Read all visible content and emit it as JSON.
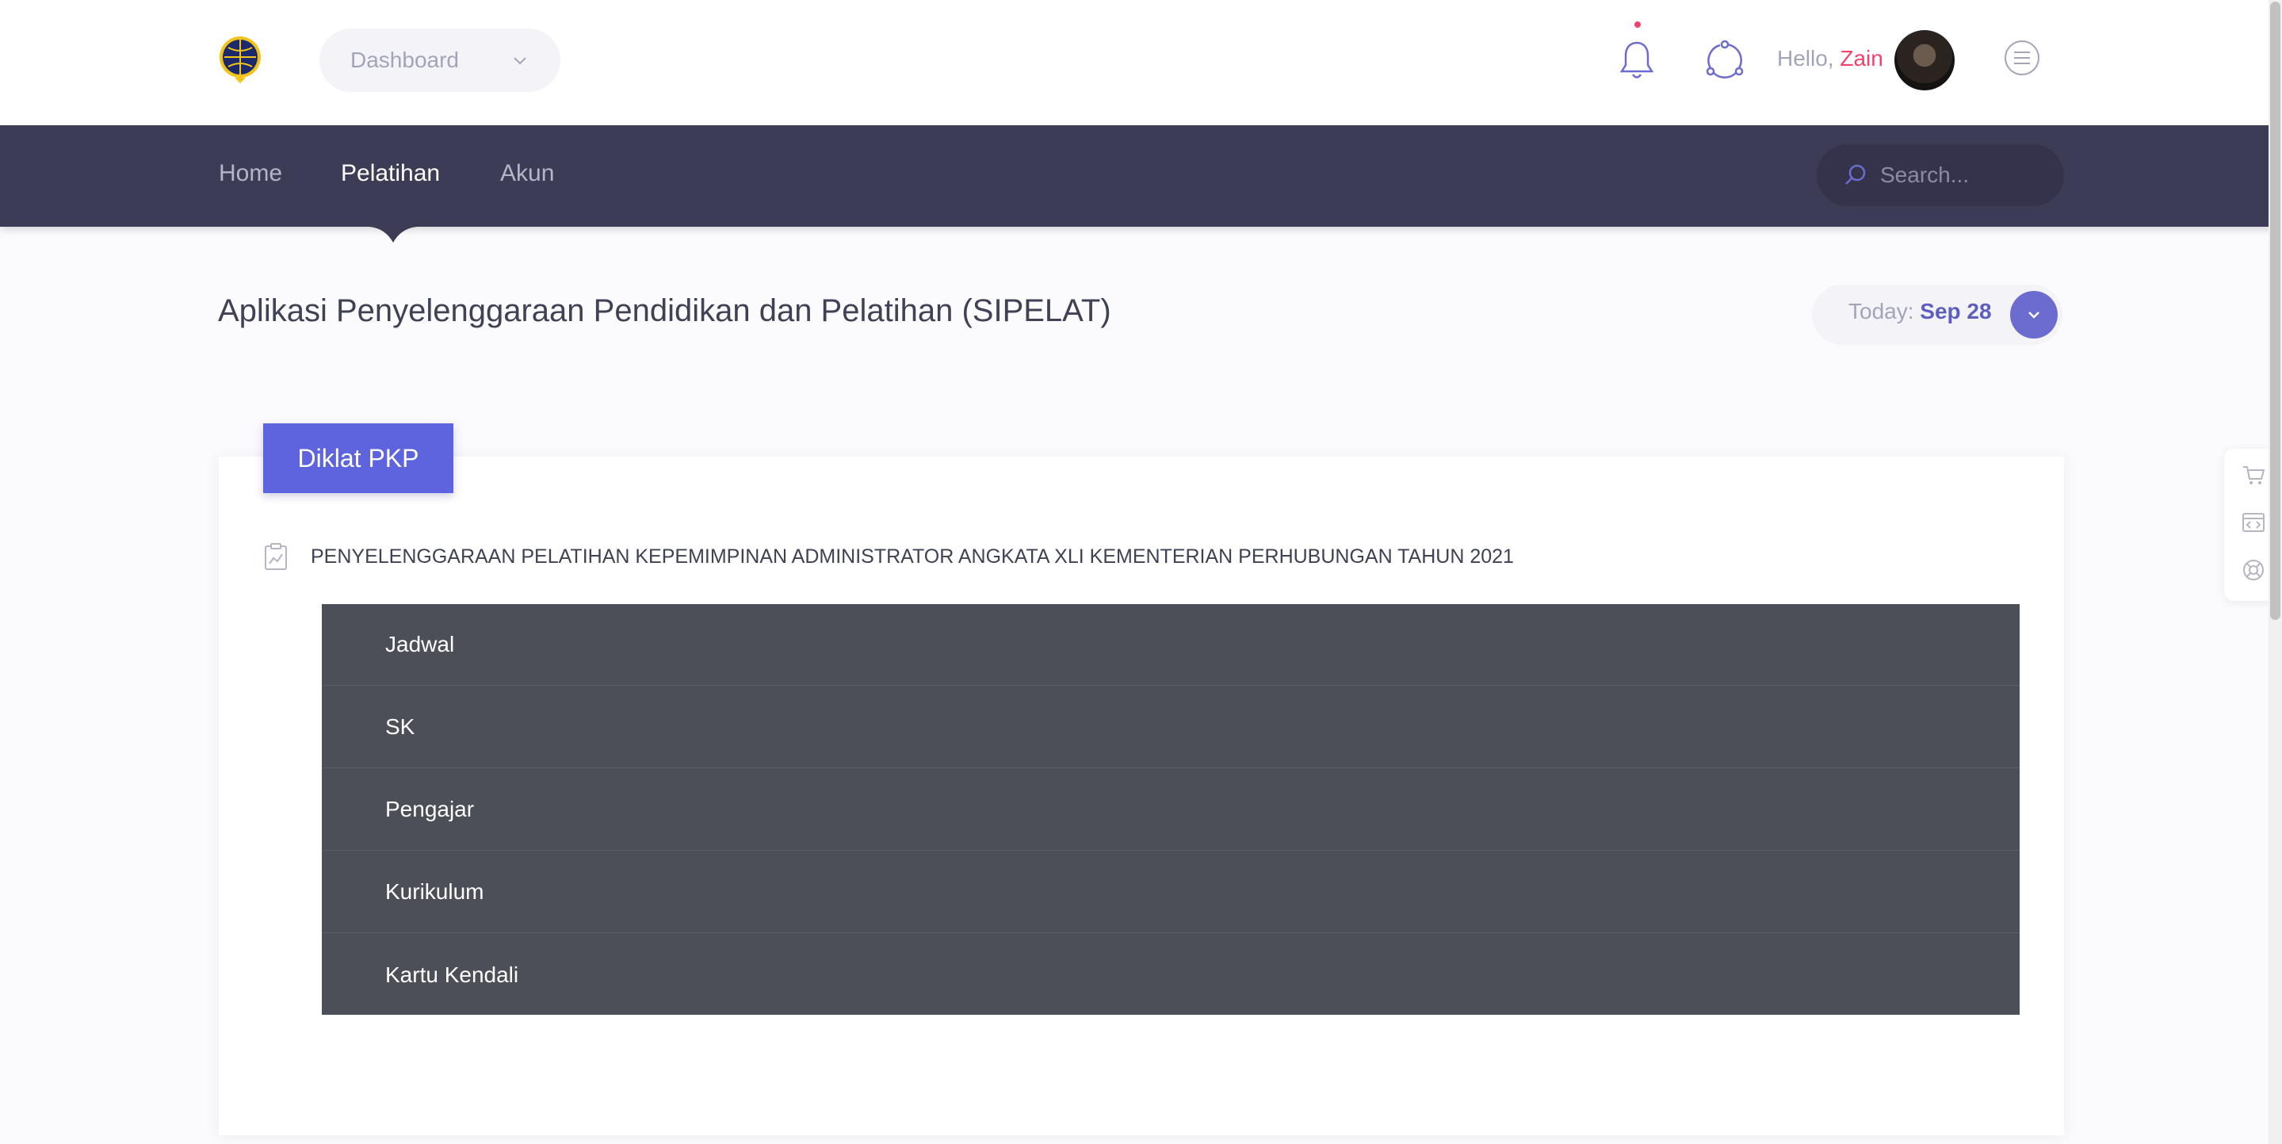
{
  "header": {
    "dashboard_label": "Dashboard",
    "hello_prefix": "Hello,",
    "user_name": "Zain"
  },
  "nav": {
    "items": [
      {
        "label": "Home"
      },
      {
        "label": "Pelatihan"
      },
      {
        "label": "Akun"
      }
    ],
    "active": "Pelatihan",
    "search_placeholder": "Search..."
  },
  "page": {
    "title": "Aplikasi Penyelenggaraan Pendidikan dan Pelatihan (SIPELAT)",
    "today_label": "Today:",
    "today_date": "Sep 28"
  },
  "card": {
    "tab_label": "Diklat PKP",
    "item_title": "PENYELENGGARAAN PELATIHAN KEPEMIMPINAN ADMINISTRATOR ANGKATA XLI KEMENTERIAN PERHUBUNGAN TAHUN 2021",
    "menu": [
      {
        "label": "Jadwal"
      },
      {
        "label": "SK"
      },
      {
        "label": "Pengajar"
      },
      {
        "label": "Kurikulum"
      },
      {
        "label": "Kartu Kendali"
      }
    ]
  },
  "side_tools": [
    "cart-icon",
    "code-icon",
    "lifebuoy-icon"
  ],
  "colors": {
    "navbar": "#3d3c56",
    "accent": "#5e64de",
    "user_name": "#f1416c",
    "list_bg": "#4c4e58"
  }
}
